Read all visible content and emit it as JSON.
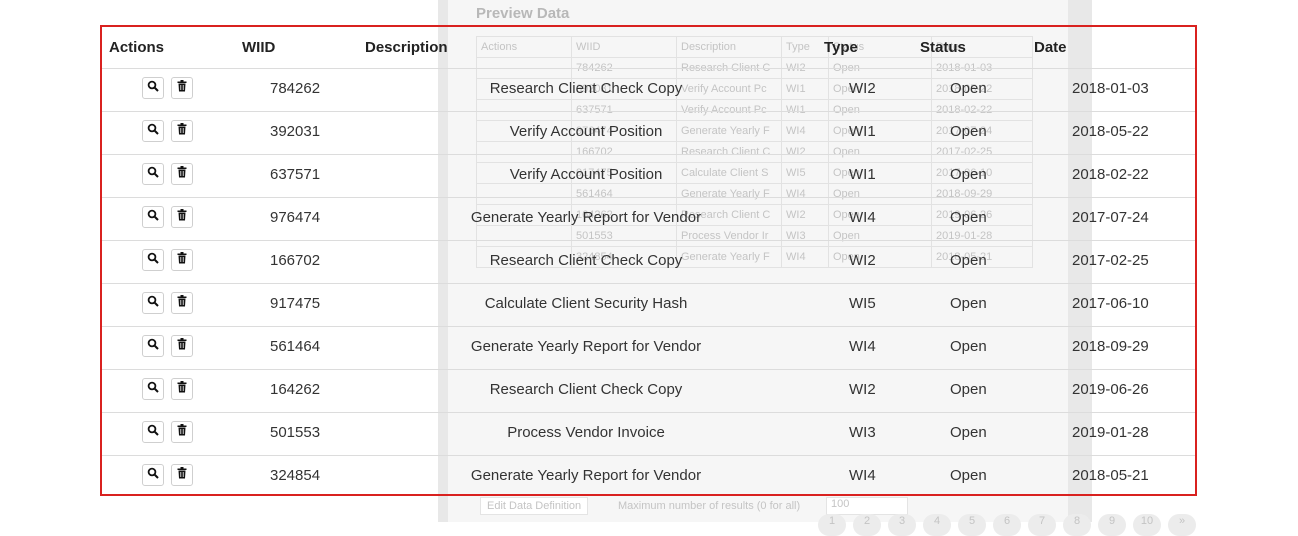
{
  "preview": {
    "title": "Preview Data",
    "columns": [
      "Actions",
      "WIID",
      "Description",
      "Type",
      "Status",
      "Date"
    ],
    "rows": [
      [
        "",
        "784262",
        "Research Client C",
        "WI2",
        "Open",
        "2018-01-03"
      ],
      [
        "",
        "392031",
        "Verify Account Pc",
        "WI1",
        "Open",
        "2018-05-22"
      ],
      [
        "",
        "637571",
        "Verify Account Pc",
        "WI1",
        "Open",
        "2018-02-22"
      ],
      [
        "",
        "976474",
        "Generate Yearly F",
        "WI4",
        "Open",
        "2017-07-24"
      ],
      [
        "",
        "166702",
        "Research Client C",
        "WI2",
        "Open",
        "2017-02-25"
      ],
      [
        "",
        "917475",
        "Calculate Client S",
        "WI5",
        "Open",
        "2017-06-10"
      ],
      [
        "",
        "561464",
        "Generate Yearly F",
        "WI4",
        "Open",
        "2018-09-29"
      ],
      [
        "",
        "164262",
        "Research Client C",
        "WI2",
        "Open",
        "2019-06-26"
      ],
      [
        "",
        "501553",
        "Process Vendor Ir",
        "WI3",
        "Open",
        "2019-01-28"
      ],
      [
        "",
        "324854",
        "Generate Yearly F",
        "WI4",
        "Open",
        "2018-05-21"
      ]
    ],
    "edit_button": "Edit Data Definition",
    "max_label": "Maximum number of results (0 for all)",
    "max_value": "100",
    "pages": [
      "1",
      "2",
      "3",
      "4",
      "5",
      "6",
      "7",
      "8",
      "9",
      "10",
      "»"
    ]
  },
  "table": {
    "headers": {
      "actions": "Actions",
      "wiid": "WIID",
      "description": "Description",
      "type": "Type",
      "status": "Status",
      "date": "Date"
    },
    "rows": [
      {
        "wiid": "784262",
        "description": "Research Client Check Copy",
        "type": "WI2",
        "status": "Open",
        "date": "2018-01-03"
      },
      {
        "wiid": "392031",
        "description": "Verify Account Position",
        "type": "WI1",
        "status": "Open",
        "date": "2018-05-22"
      },
      {
        "wiid": "637571",
        "description": "Verify Account Position",
        "type": "WI1",
        "status": "Open",
        "date": "2018-02-22"
      },
      {
        "wiid": "976474",
        "description": "Generate Yearly Report for Vendor",
        "type": "WI4",
        "status": "Open",
        "date": "2017-07-24"
      },
      {
        "wiid": "166702",
        "description": "Research Client Check Copy",
        "type": "WI2",
        "status": "Open",
        "date": "2017-02-25"
      },
      {
        "wiid": "917475",
        "description": "Calculate Client Security Hash",
        "type": "WI5",
        "status": "Open",
        "date": "2017-06-10"
      },
      {
        "wiid": "561464",
        "description": "Generate Yearly Report for Vendor",
        "type": "WI4",
        "status": "Open",
        "date": "2018-09-29"
      },
      {
        "wiid": "164262",
        "description": "Research Client Check Copy",
        "type": "WI2",
        "status": "Open",
        "date": "2019-06-26"
      },
      {
        "wiid": "501553",
        "description": "Process Vendor Invoice",
        "type": "WI3",
        "status": "Open",
        "date": "2019-01-28"
      },
      {
        "wiid": "324854",
        "description": "Generate Yearly Report for Vendor",
        "type": "WI4",
        "status": "Open",
        "date": "2018-05-21"
      }
    ],
    "row_icons": {
      "view": "magnifier-icon",
      "delete": "trash-icon"
    }
  },
  "colors": {
    "highlight_border": "#d9211f",
    "divider": "#dcdcdc"
  }
}
